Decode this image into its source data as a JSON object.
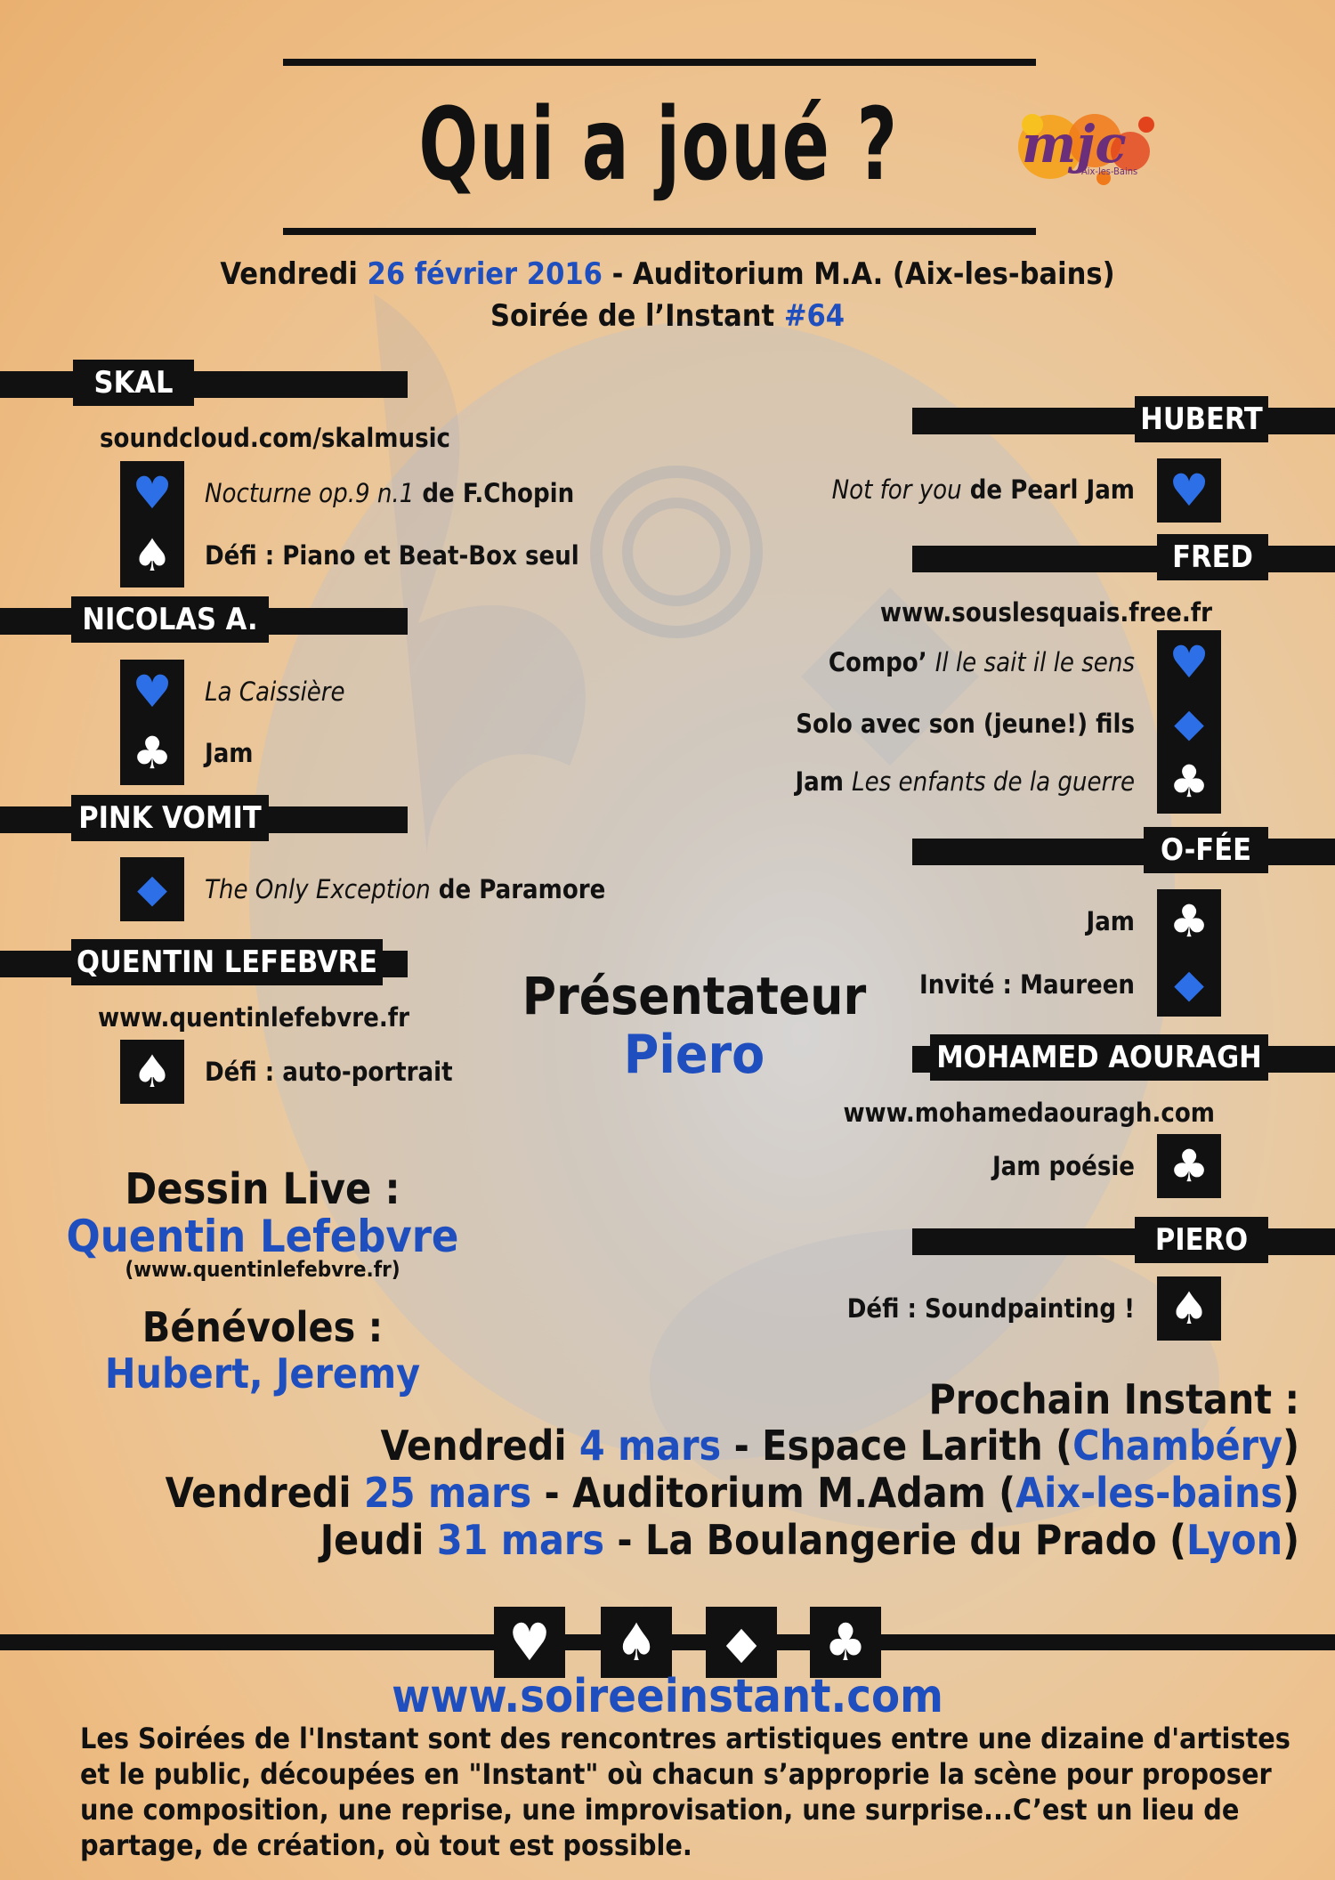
{
  "title": "Qui a joué ?",
  "event": {
    "day": "Vendredi",
    "date": "26 février 2016",
    "sep": " - ",
    "venue": "Auditorium M.A. (Aix-les-bains)",
    "soiree_prefix": "Soirée de l’Instant",
    "soiree_number": "#64"
  },
  "logo": {
    "text": "mjc",
    "subtext": "Aix-les-Bains"
  },
  "left_artists": [
    {
      "name": "SKAL",
      "link": "soundcloud.com/skalmusic",
      "items": [
        {
          "icon": "heart",
          "italic": "Nocturne op.9 n.1",
          "text": " de F.Chopin"
        },
        {
          "icon": "spade",
          "italic": "",
          "text": "Défi : Piano et Beat-Box seul"
        }
      ]
    },
    {
      "name": "NICOLAS A.",
      "link": "",
      "items": [
        {
          "icon": "heart",
          "italic": "La Caissière",
          "text": ""
        },
        {
          "icon": "club",
          "italic": "",
          "text": "Jam"
        }
      ]
    },
    {
      "name": "PINK VOMIT",
      "link": "",
      "items": [
        {
          "icon": "diamond",
          "italic": "The Only Exception",
          "text": " de Paramore"
        }
      ]
    },
    {
      "name": "QUENTIN LEFEBVRE",
      "link": "www.quentinlefebvre.fr",
      "items": [
        {
          "icon": "spade",
          "italic": "",
          "text": "Défi : auto-portrait"
        }
      ]
    }
  ],
  "right_artists": [
    {
      "name": "HUBERT",
      "link": "",
      "items": [
        {
          "icon": "heart",
          "italic": "Not for you",
          "text": " de Pearl Jam"
        }
      ]
    },
    {
      "name": "FRED",
      "link": "www.souslesquais.free.fr",
      "items": [
        {
          "icon": "heart",
          "pre": "Compo’ ",
          "italic": "Il le sait il le sens",
          "text": ""
        },
        {
          "icon": "diamond",
          "italic": "",
          "text": "Solo avec son (jeune!) fils"
        },
        {
          "icon": "club",
          "pre": "Jam  ",
          "italic": "Les enfants de la guerre",
          "text": ""
        }
      ]
    },
    {
      "name": "O-FÉE",
      "link": "",
      "items": [
        {
          "icon": "club",
          "italic": "",
          "text": "Jam"
        },
        {
          "icon": "diamond",
          "italic": "",
          "text": "Invité : Maureen"
        }
      ]
    },
    {
      "name": "MOHAMED AOURAGH",
      "link": "www.mohamedaouragh.com",
      "items": [
        {
          "icon": "club",
          "italic": "",
          "text": "Jam poésie"
        }
      ]
    },
    {
      "name": "PIERO",
      "link": "",
      "items": [
        {
          "icon": "spade",
          "italic": "",
          "text": "Défi : Soundpainting !"
        }
      ]
    }
  ],
  "presenter": {
    "label": "Présentateur",
    "name": "Piero"
  },
  "drawing": {
    "label": "Dessin Live :",
    "name": "Quentin Lefebvre",
    "link": "(www.quentinlefebvre.fr)"
  },
  "volunteers": {
    "label": "Bénévoles :",
    "names": "Hubert, Jeremy"
  },
  "next": {
    "label": "Prochain Instant :",
    "dates": [
      {
        "day": "Vendredi",
        "date": "4 mars",
        "place": " - Espace Larith (",
        "city": "Chambéry",
        "end": ")"
      },
      {
        "day": "Vendredi",
        "date": "25 mars",
        "place": " - Auditorium M.Adam (",
        "city": "Aix-les-bains",
        "end": ")"
      },
      {
        "day": "Jeudi",
        "date": "31 mars",
        "place": " - La Boulangerie du Prado (",
        "city": "Lyon",
        "end": ")"
      }
    ]
  },
  "footer": {
    "suits": [
      "heart",
      "spade",
      "diamond",
      "club"
    ],
    "website": "www.soireeinstant.com",
    "description": "Les Soirées de l'Instant sont des rencontres artistiques entre une dizaine d'artistes et le public, découpées en \"Instant\" où chacun s’approprie la scène pour proposer une composition, une reprise, une improvisation, une surprise...C’est un lieu de partage, de création, où tout est possible."
  },
  "colors": {
    "accent_blue": "#1f4fbf",
    "icon_blue": "#2c6fe6",
    "ink": "#111111",
    "background": "#eec08a"
  },
  "icons": {
    "heart": "♥",
    "spade": "♠",
    "diamond": "◆",
    "club": "♣"
  }
}
